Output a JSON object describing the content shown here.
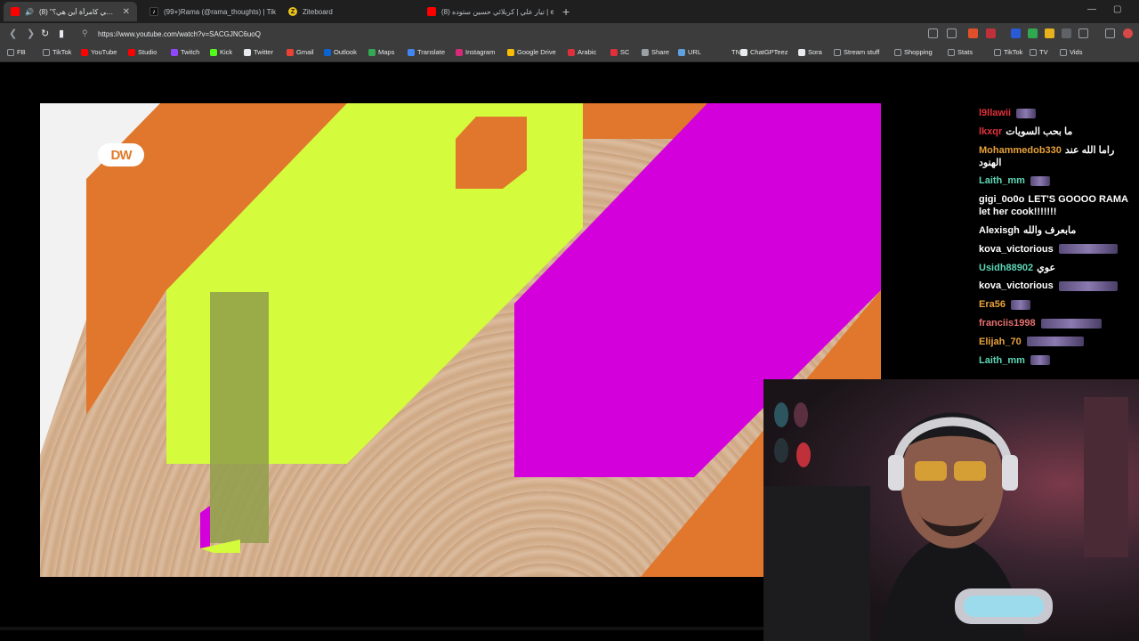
{
  "tabs": [
    {
      "title": "(8) \"حقوقي كامرأة أين هي؟\" |",
      "icon": "youtube-icon",
      "active": true
    },
    {
      "title": "(99+)Rama (@rama_thoughts) | TikT",
      "icon": "tiktok-icon",
      "active": false
    },
    {
      "title": "Ziteboard",
      "icon": "ziteboard-icon",
      "active": false
    },
    {
      "title": "(8) تيار علي | كربلائي حسين ستوده | e",
      "icon": "youtube-icon",
      "active": false
    }
  ],
  "address": {
    "url": "https://www.youtube.com/watch?v=SACGJNC6uoQ"
  },
  "bookmarks": [
    {
      "label": "FB",
      "icon": "folder-icon"
    },
    {
      "label": "TikTok",
      "icon": "folder-icon"
    },
    {
      "label": "YouTube",
      "icon": "youtube-icon"
    },
    {
      "label": "Studio",
      "icon": "youtube-studio-icon"
    },
    {
      "label": "Twitch",
      "icon": "twitch-icon"
    },
    {
      "label": "Kick",
      "icon": "kick-icon"
    },
    {
      "label": "Twitter",
      "icon": "x-icon"
    },
    {
      "label": "Gmail",
      "icon": "gmail-icon"
    },
    {
      "label": "Outlook",
      "icon": "outlook-icon"
    },
    {
      "label": "Maps",
      "icon": "maps-icon"
    },
    {
      "label": "Translate",
      "icon": "translate-icon"
    },
    {
      "label": "Instagram",
      "icon": "instagram-icon"
    },
    {
      "label": "Google Drive",
      "icon": "drive-icon"
    },
    {
      "label": "Arabic",
      "icon": "arabic-icon"
    },
    {
      "label": "SC",
      "icon": "sc-icon"
    },
    {
      "label": "Share",
      "icon": "cloud-icon"
    },
    {
      "label": "URL",
      "icon": "url-icon"
    },
    {
      "label": "TN",
      "icon": "tn-icon"
    },
    {
      "label": "ChatGPTeez",
      "icon": "chatgpt-icon"
    },
    {
      "label": "Sora",
      "icon": "sora-icon"
    },
    {
      "label": "Stream stuff",
      "icon": "folder-icon"
    },
    {
      "label": "Shopping",
      "icon": "folder-icon"
    },
    {
      "label": "Stats",
      "icon": "folder-icon"
    },
    {
      "label": "TikTok",
      "icon": "folder-icon"
    },
    {
      "label": "TV",
      "icon": "folder-icon"
    },
    {
      "label": "Vids",
      "icon": "folder-icon"
    }
  ],
  "video": {
    "logo_text": "DW"
  },
  "chat": [
    {
      "user": "l9llawii",
      "color": "#e0303a",
      "text": "",
      "emote": true
    },
    {
      "user": "lkxqr",
      "color": "#e0303a",
      "text": "ما بحب السويات",
      "emote": false
    },
    {
      "user": "Mohammedob330",
      "color": "#e8a13a",
      "text": "راما الله عند الهنود",
      "emote": false
    },
    {
      "user": "Laith_mm",
      "color": "#5ed6b4",
      "text": "",
      "emote": true
    },
    {
      "user": "gigi_0o0o",
      "color": "#ffffff",
      "text": "LET'S GOOOO RAMA let her cook!!!!!!!",
      "emote": false
    },
    {
      "user": "Alexisgh",
      "color": "#ffffff",
      "text": "مابعرف والله",
      "emote": false
    },
    {
      "user": "kova_victorious",
      "color": "#ffffff",
      "text": "",
      "emote": true
    },
    {
      "user": "Usidh88902",
      "color": "#5ed6b4",
      "text": "عوي",
      "emote": false
    },
    {
      "user": "kova_victorious",
      "color": "#ffffff",
      "text": "",
      "emote": true
    },
    {
      "user": "Era56",
      "color": "#e8a13a",
      "text": "",
      "emote": true
    },
    {
      "user": "franciis1998",
      "color": "#e87070",
      "text": "",
      "emote": true
    },
    {
      "user": "Elijah_70",
      "color": "#e8a13a",
      "text": "",
      "emote": true
    },
    {
      "user": "Laith_mm",
      "color": "#5ed6b4",
      "text": "",
      "emote": true
    }
  ]
}
